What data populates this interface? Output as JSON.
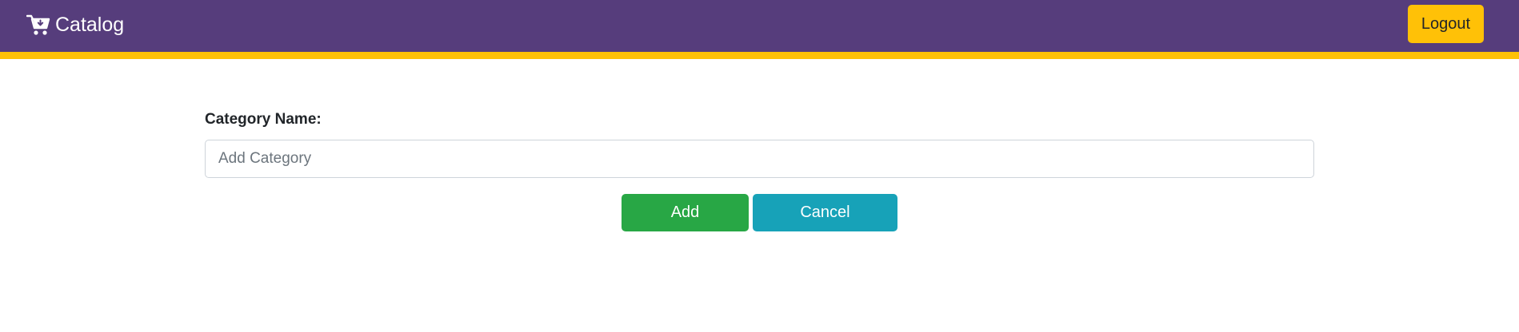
{
  "navbar": {
    "brand_label": "Catalog",
    "brand_icon": "shopping-cart-download-icon",
    "logout_label": "Logout",
    "colors": {
      "background": "#563d7c",
      "accent_border": "#ffc107",
      "logout_button": "#ffc107"
    }
  },
  "form": {
    "category_label": "Category Name:",
    "category_input": {
      "value": "",
      "placeholder": "Add Category"
    },
    "add_label": "Add",
    "cancel_label": "Cancel",
    "colors": {
      "add_button": "#28a745",
      "cancel_button": "#17a2b8"
    }
  }
}
